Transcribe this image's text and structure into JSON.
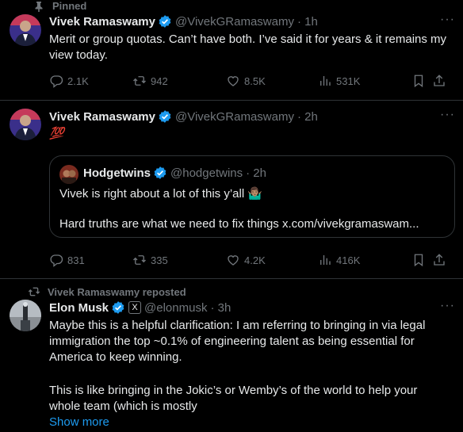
{
  "tweets": [
    {
      "context": "Pinned",
      "name": "Vivek Ramaswamy",
      "handle": "@VivekGRamaswamy",
      "time": "· 1h",
      "text": "Merit or group quotas. Can’t have both. I’ve said it for years & it remains my view today.",
      "replies": "2.1K",
      "reposts": "942",
      "likes": "8.5K",
      "views": "531K"
    },
    {
      "name": "Vivek Ramaswamy",
      "handle": "@VivekGRamaswamy",
      "time": "· 2h",
      "text": "💯",
      "quote": {
        "name": "Hodgetwins",
        "handle": "@hodgetwins",
        "time": "· 2h",
        "line1": "Vivek is right about a lot of this y’all 🤷🏽‍♂️",
        "line2": "Hard truths are what we need to fix things x.com/vivekgramaswam..."
      },
      "replies": "831",
      "reposts": "335",
      "likes": "4.2K",
      "views": "416K"
    },
    {
      "context": "Vivek Ramaswamy reposted",
      "name": "Elon Musk",
      "badge": "X",
      "handle": "@elonmusk",
      "time": "· 3h",
      "para1": "Maybe this is a helpful clarification: I am referring to bringing in via legal immigration the top ~0.1% of engineering talent as being essential for America to keep winning.",
      "para2": "This is like bringing in the Jokic’s or Wemby’s of the world to help your whole team (which is mostly",
      "show_more": "Show more"
    }
  ],
  "colors": {
    "background": "#000000",
    "text": "#e7e9ea",
    "muted": "#71767b",
    "border": "#2f3336",
    "verified": "#1d9bf0",
    "link": "#1d9bf0",
    "hundred": "#e0245e"
  },
  "icons": [
    "pin-icon",
    "verified-badge-icon",
    "more-icon",
    "reply-icon",
    "repost-icon",
    "like-icon",
    "views-icon",
    "bookmark-icon",
    "share-icon",
    "x-logo-badge"
  ]
}
